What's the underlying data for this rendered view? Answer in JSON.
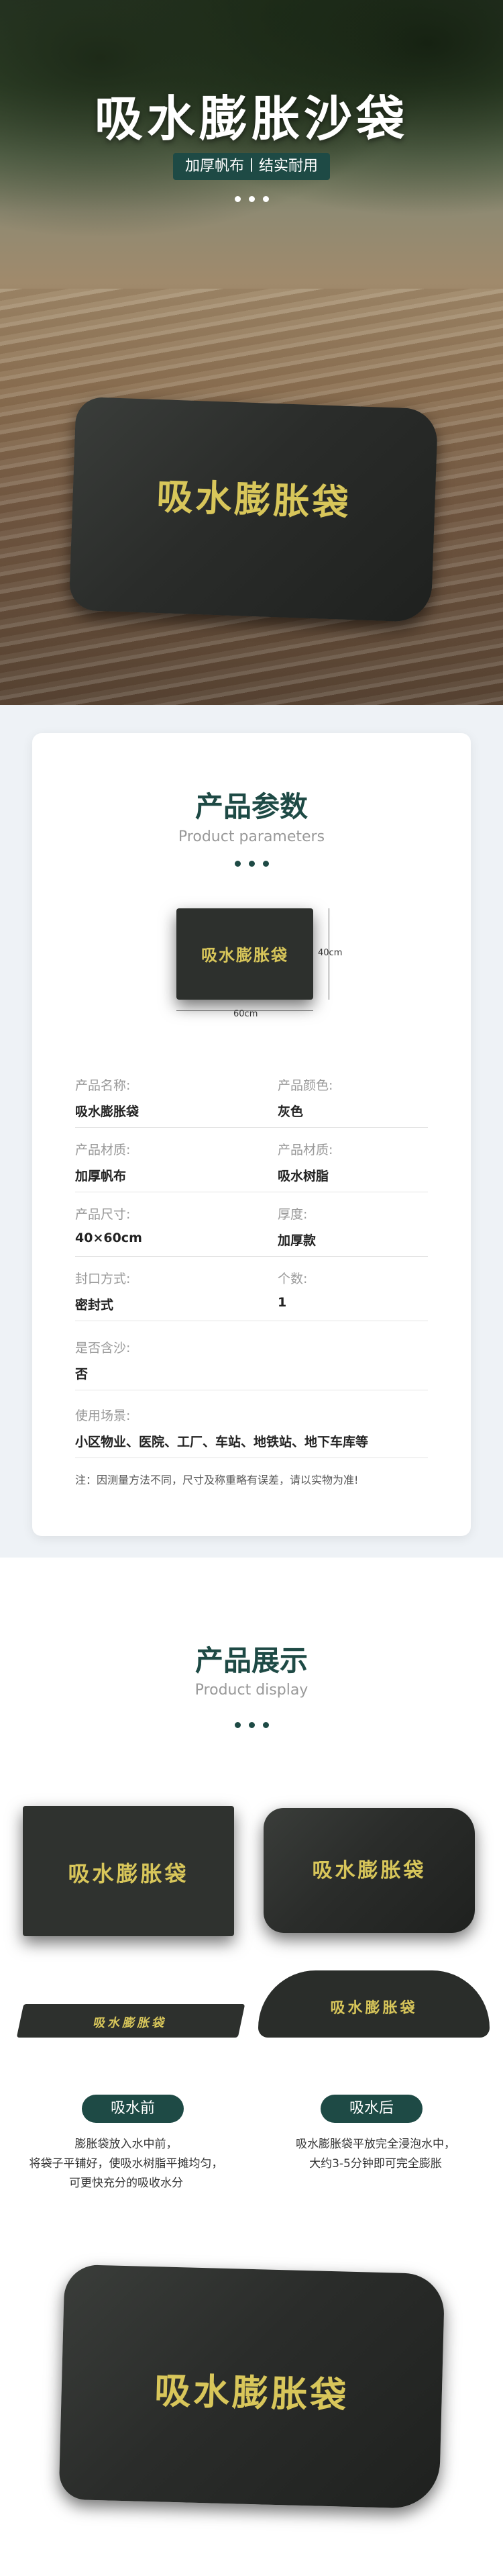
{
  "hero": {
    "title": "吸水膨胀沙袋",
    "tagline": "加厚帆布丨结实耐用",
    "bag_text": "吸水膨胀袋"
  },
  "params": {
    "title": "产品参数",
    "subtitle": "Product parameters",
    "bag_text": "吸水膨胀袋",
    "height_label": "40cm",
    "width_label": "60cm",
    "rows": [
      {
        "l1": "产品名称:",
        "v1": "吸水膨胀袋",
        "l2": "产品颜色:",
        "v2": "灰色"
      },
      {
        "l1": "产品材质:",
        "v1": "加厚帆布",
        "l2": "产品材质:",
        "v2": "吸水树脂"
      },
      {
        "l1": "产品尺寸:",
        "v1": "40×60cm",
        "l2": "厚度:",
        "v2": "加厚款"
      },
      {
        "l1": "封口方式:",
        "v1": "密封式",
        "l2": "个数:",
        "v2": "1"
      },
      {
        "l1": "是否含沙:",
        "v1": "否"
      },
      {
        "l1": "使用场景:",
        "v1": "小区物业、医院、工厂、车站、地铁站、地下车库等"
      }
    ],
    "note": "注：因测量方法不同，尺寸及称重略有误差，请以实物为准!"
  },
  "display": {
    "title": "产品展示",
    "subtitle": "Product display",
    "bag_text": "吸水膨胀袋",
    "before_label": "吸水前",
    "before_desc": [
      "膨胀袋放入水中前，",
      "将袋子平铺好，使吸水树脂平摊均匀，",
      "可更快充分的吸收水分"
    ],
    "after_label": "吸水后",
    "after_desc": [
      "吸水膨胀袋平放完全浸泡水中，",
      "大约3-5分钟即可完全膨胀"
    ]
  },
  "colors": {
    "accent": "#1e4a45",
    "bag_text": "#d8c65a"
  }
}
